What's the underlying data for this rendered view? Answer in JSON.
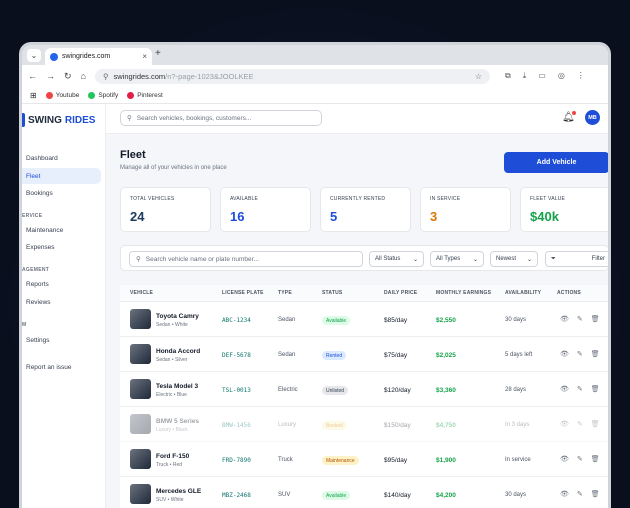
{
  "browser": {
    "tab_title": "swingrides.com",
    "url_host": "swingrides.com",
    "url_rest": "/n?-page-1023&JOOLKEE"
  },
  "bookmarks": [
    {
      "label": "Youtube",
      "color": "#ef4444"
    },
    {
      "label": "Spotify",
      "color": "#22c55e"
    },
    {
      "label": "Pinterest",
      "color": "#e11d48"
    }
  ],
  "brand": {
    "swing": "SWING",
    "rides": "RIDES"
  },
  "sidebar": {
    "sections": [
      {
        "title": "",
        "items": [
          {
            "label": "Dashboard"
          },
          {
            "label": "Fleet",
            "active": true
          },
          {
            "label": "Bookings"
          }
        ]
      },
      {
        "title": "ERVICE",
        "items": [
          {
            "label": "Maintenance"
          },
          {
            "label": "Expenses"
          }
        ]
      },
      {
        "title": "AGEMENT",
        "items": [
          {
            "label": "Reports"
          },
          {
            "label": "Reviews"
          }
        ]
      },
      {
        "title": "M",
        "items": [
          {
            "label": "Settings"
          }
        ]
      },
      {
        "title": "",
        "items": [
          {
            "label": "Report an issue"
          }
        ]
      }
    ]
  },
  "topbar": {
    "search_placeholder": "Search vehicles, bookings, customers...",
    "avatar": "MB"
  },
  "page": {
    "title": "Fleet",
    "subtitle": "Manage all of your vehicles in one place",
    "add_button": "Add Vehicle"
  },
  "stats": [
    {
      "label": "Total Vehicles",
      "value": "24",
      "color": "#1e3a5f"
    },
    {
      "label": "Available",
      "value": "16",
      "color": "#1e4ed8"
    },
    {
      "label": "Currently Rented",
      "value": "5",
      "color": "#1e4ed8"
    },
    {
      "label": "In Service",
      "value": "3",
      "color": "#d97706"
    },
    {
      "label": "Fleet Value",
      "value": "$40k",
      "color": "#16a34a"
    }
  ],
  "filters": {
    "search_placeholder": "Search vehicle name or plate number...",
    "status": "All Status",
    "types": "All Types",
    "sort": "Newest",
    "filter": "Filter"
  },
  "table": {
    "headers": [
      "VEHICLE",
      "LICENSE PLATE",
      "TYPE",
      "STATUS",
      "DAILY PRICE",
      "MONTHLY EARNINGS",
      "AVAILABILITY",
      "ACTIONS"
    ],
    "rows": [
      {
        "name": "Toyota Camry",
        "sub": "Sedan • White",
        "plate": "ABC-1234",
        "type": "Sedan",
        "status": "Available",
        "price": "$85/day",
        "earn": "$2,550",
        "avail": "30 days",
        "faded": false
      },
      {
        "name": "Honda Accord",
        "sub": "Sedan • Silver",
        "plate": "DEF-5678",
        "type": "Sedan",
        "status": "Rented",
        "price": "$75/day",
        "earn": "$2,025",
        "avail": "5 days left",
        "faded": false
      },
      {
        "name": "Tesla Model 3",
        "sub": "Electric • Blue",
        "plate": "TSL-0013",
        "type": "Electric",
        "status": "Unlisted",
        "price": "$120/day",
        "earn": "$3,360",
        "avail": "28 days",
        "faded": false
      },
      {
        "name": "BMW 5 Series",
        "sub": "Luxury • Black",
        "plate": "BMW-1456",
        "type": "Luxury",
        "status": "Booked",
        "price": "$150/day",
        "earn": "$4,750",
        "avail": "In 3 days",
        "faded": true
      },
      {
        "name": "Ford F-150",
        "sub": "Truck • Red",
        "plate": "FRD-7890",
        "type": "Truck",
        "status": "Maintenance",
        "price": "$95/day",
        "earn": "$1,900",
        "avail": "In service",
        "faded": false
      },
      {
        "name": "Mercedes GLE",
        "sub": "SUV • White",
        "plate": "MBZ-2468",
        "type": "SUV",
        "status": "Available",
        "price": "$140/day",
        "earn": "$4,200",
        "avail": "30 days",
        "faded": false
      }
    ]
  },
  "status_colors": {
    "Available": [
      "#dcfce7",
      "#16a34a"
    ],
    "Rented": [
      "#dbeafe",
      "#1e4ed8"
    ],
    "Unlisted": [
      "#e5e7eb",
      "#374151"
    ],
    "Booked": [
      "#fef3c7",
      "#d97706"
    ],
    "Maintenance": [
      "#fef3c7",
      "#b45309"
    ]
  }
}
